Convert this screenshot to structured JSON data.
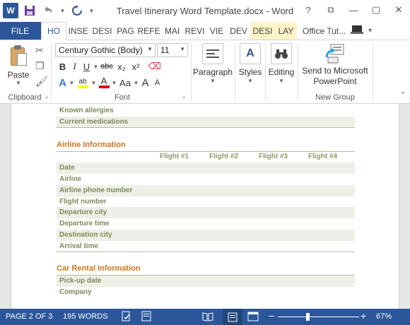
{
  "window": {
    "title": "Travel Itinerary Word Template.docx - Word",
    "app_icon_text": "W"
  },
  "qat": {
    "save_icon": "save-icon",
    "undo_icon": "undo-icon",
    "redo_icon": "redo-icon"
  },
  "window_controls": [
    "?",
    "⧉",
    "—",
    "▢",
    "✕"
  ],
  "tabs": {
    "file": "FILE",
    "items": [
      "HO",
      "INSE",
      "DESI",
      "PAG",
      "REFE",
      "MAI",
      "REVI",
      "VIE",
      "DEV",
      "DESI",
      "LAY"
    ],
    "user": "Office Tut..."
  },
  "ribbon": {
    "clipboard": {
      "paste_label": "Paste",
      "group_label": "Clipboard"
    },
    "font": {
      "font_name": "Century Gothic (Body)",
      "font_size": "11",
      "group_label": "Font",
      "row1": [
        "B",
        "I",
        "U",
        "abc",
        "x₂",
        "x²"
      ],
      "row2": [
        "A",
        "ab",
        "A",
        "Aa",
        "A",
        "A"
      ]
    },
    "paragraph": {
      "label": "Paragraph"
    },
    "styles": {
      "label": "Styles"
    },
    "editing": {
      "label": "Editing"
    },
    "send": {
      "label_line1": "Send to Microsoft",
      "label_line2": "PowerPoint",
      "group_label": "New Group"
    }
  },
  "document": {
    "top_rows": [
      "Known allergies",
      "Current medications"
    ],
    "airline": {
      "title": "Airline Information",
      "flights": [
        "Flight #1",
        "Flight #2",
        "Flight #3",
        "Flight #4"
      ],
      "rows": [
        "Date",
        "Airline",
        "Airline phone number",
        "Flight number",
        "Departure city",
        "Departure time",
        "Destination city",
        "Arrival time"
      ]
    },
    "car_rental": {
      "title": "Car Rental Information",
      "rows": [
        "Pick-up date",
        "Company"
      ]
    }
  },
  "status": {
    "page": "PAGE 2 OF 3",
    "words": "195 WORDS",
    "zoom": "67%"
  },
  "colors": {
    "accent": "#2b579a",
    "section_title": "#d0741b",
    "row_label": "#7d8a5c",
    "row_shade": "#eeefe6"
  }
}
